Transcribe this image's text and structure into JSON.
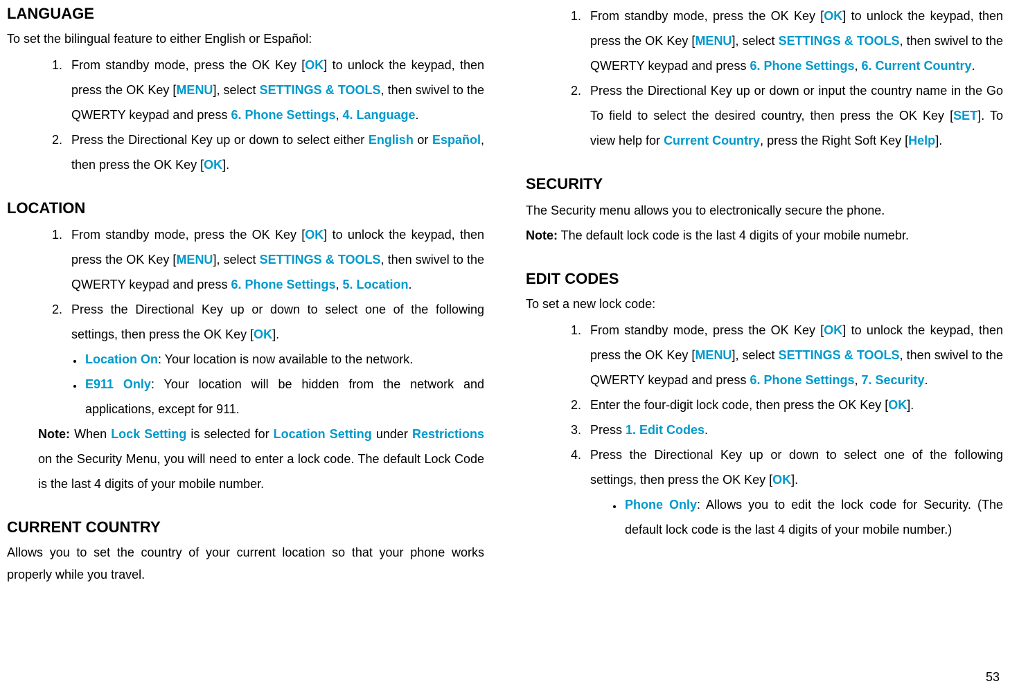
{
  "left": {
    "language": {
      "heading": "LANGUAGE",
      "intro": "To set the bilingual feature to either English or Español:",
      "step1_a": "From standby mode, press the OK Key [",
      "step1_b": "] to unlock the keypad, then press the OK Key [",
      "step1_c": "], select ",
      "step1_d": ", then swivel to the QWERTY keypad and press ",
      "step1_e": ", ",
      "step1_f": ".",
      "ok": "OK",
      "menu": "MENU",
      "settings": "SETTINGS & TOOLS",
      "six_phone": "6. Phone Settings",
      "four_lang": "4. Language",
      "step2_a": "Press the Directional Key up or down to select either ",
      "step2_b": " or ",
      "step2_c": ", then press the OK Key [",
      "step2_d": "].",
      "english": "English",
      "espanol": "Español"
    },
    "location": {
      "heading": "LOCATION",
      "step1_a": "From standby mode, press the OK Key [",
      "step1_b": "] to unlock the keypad, then press the OK Key [",
      "step1_c": "], select ",
      "step1_d": ", then swivel to the QWERTY keypad and press ",
      "step1_e": ", ",
      "step1_f": ".",
      "ok": "OK",
      "menu": "MENU",
      "settings": "SETTINGS & TOOLS",
      "six_phone": "6. Phone Settings",
      "five_location": "5. Location",
      "step2_a": "Press the Directional Key up or down to select one of the following settings, then press the OK Key [",
      "step2_b": "].",
      "bullet1_label": "Location On",
      "bullet1_text": ": Your location is now available to the network.",
      "bullet2_label": "E911 Only",
      "bullet2_text": ": Your location will be hidden from the network and applications, except for 911.",
      "note_label": "Note:",
      "note_a": " When ",
      "note_b": " is selected for ",
      "note_c": " under ",
      "note_d": " on the Security Menu, you will need to enter a lock code. The default Lock Code is the last 4 digits of your mobile number.",
      "lock_setting": "Lock Setting",
      "location_setting": "Location Setting",
      "restrictions": "Restrictions"
    },
    "country": {
      "heading": "CURRENT COUNTRY",
      "intro": "Allows you to set the country of your current location so that your phone works properly while you travel."
    }
  },
  "right": {
    "country_cont": {
      "step1_a": "From standby mode, press the OK Key [",
      "step1_b": "] to unlock the keypad, then press the OK Key [",
      "step1_c": "], select ",
      "step1_d": ", then swivel to the QWERTY keypad and press ",
      "step1_e": ", ",
      "step1_f": ".",
      "ok": "OK",
      "menu": "MENU",
      "settings": "SETTINGS & TOOLS",
      "six_phone": "6. Phone Settings",
      "six_country": "6. Current Country",
      "step2_a": "Press the Directional Key up or down or input the country name in the Go To field to select the desired country, then press the OK Key [",
      "step2_b": "]. To view help for ",
      "step2_c": ", press the Right Soft Key [",
      "step2_d": "].",
      "set": "SET",
      "current_country": "Current Country",
      "help": "Help"
    },
    "security": {
      "heading": "SECURITY",
      "intro": "The Security menu allows you to electronically secure the phone.",
      "note_label": "Note:",
      "note_text": " The default lock code is the last 4 digits of your mobile numebr."
    },
    "edit_codes": {
      "heading": "EDIT CODES",
      "intro": "To set a new lock code:",
      "step1_a": "From standby mode, press the OK Key [",
      "step1_b": "] to unlock the keypad, then press the OK Key [",
      "step1_c": "], select ",
      "step1_d": ", then swivel to the QWERTY keypad and press ",
      "step1_e": ", ",
      "step1_f": ".",
      "ok": "OK",
      "menu": "MENU",
      "settings": "SETTINGS & TOOLS",
      "six_phone": "6. Phone Settings",
      "seven_security": "7. Security",
      "step2_a": "Enter the four-digit lock code, then press the OK Key [",
      "step2_b": "].",
      "step3_a": "Press ",
      "step3_b": ".",
      "one_edit": "1. Edit Codes",
      "step4_a": "Press the Directional Key up or down to select one of the following settings, then press the OK Key [",
      "step4_b": "].",
      "bullet1_label": "Phone Only",
      "bullet1_text": ": Allows you to edit the lock code for Security. (The default lock code is the last 4 digits of your mobile number.)"
    }
  },
  "page_number": "53"
}
